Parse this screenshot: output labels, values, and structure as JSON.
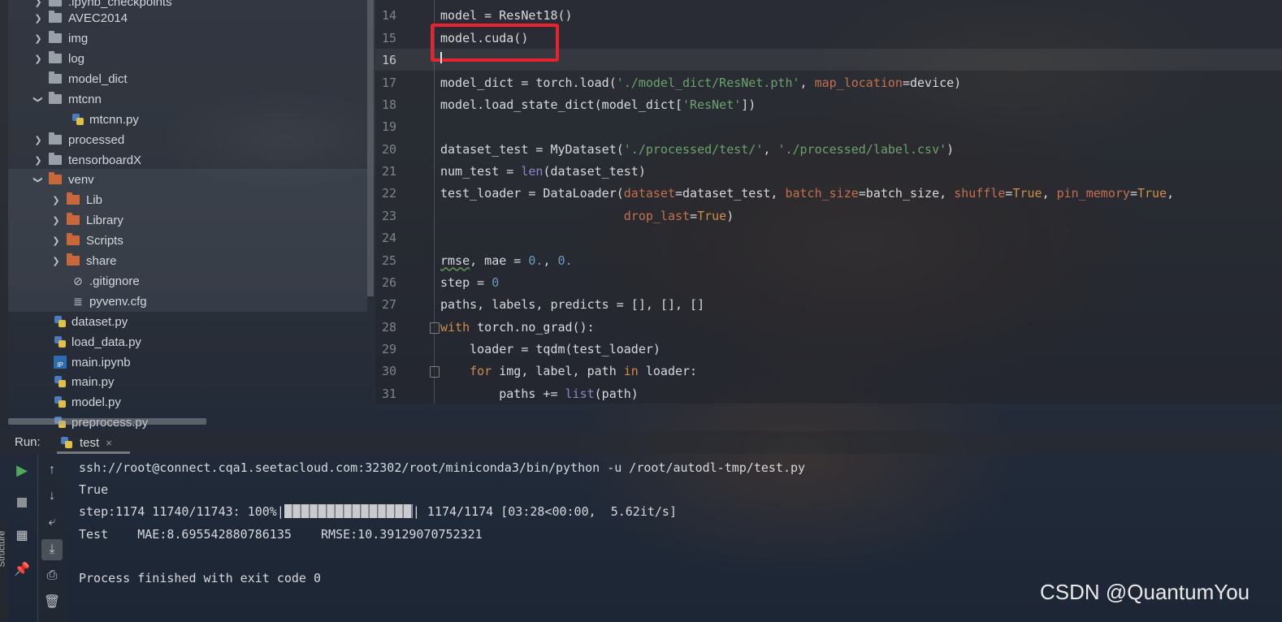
{
  "project_tree": {
    "items": [
      {
        "label": ".ipynb_checkpoints",
        "type": "folder",
        "expanded": false
      },
      {
        "label": "AVEC2014",
        "type": "folder",
        "expanded": false
      },
      {
        "label": "img",
        "type": "folder",
        "expanded": false
      },
      {
        "label": "log",
        "type": "folder",
        "expanded": false
      },
      {
        "label": "model_dict",
        "type": "folder",
        "expanded": false
      },
      {
        "label": "mtcnn",
        "type": "folder",
        "expanded": true
      },
      {
        "label": "mtcnn.py",
        "type": "python"
      },
      {
        "label": "processed",
        "type": "folder",
        "expanded": false
      },
      {
        "label": "tensorboardX",
        "type": "folder",
        "expanded": false
      },
      {
        "label": "venv",
        "type": "folder-excluded",
        "expanded": true
      },
      {
        "label": "Lib",
        "type": "folder-excluded",
        "expanded": false
      },
      {
        "label": "Library",
        "type": "folder-excluded",
        "expanded": false
      },
      {
        "label": "Scripts",
        "type": "folder-excluded",
        "expanded": false
      },
      {
        "label": "share",
        "type": "folder-excluded",
        "expanded": false
      },
      {
        "label": ".gitignore",
        "type": "ignore-file"
      },
      {
        "label": "pyvenv.cfg",
        "type": "config-file"
      },
      {
        "label": "dataset.py",
        "type": "python"
      },
      {
        "label": "load_data.py",
        "type": "python"
      },
      {
        "label": "main.ipynb",
        "type": "notebook"
      },
      {
        "label": "main.py",
        "type": "python"
      },
      {
        "label": "model.py",
        "type": "python"
      },
      {
        "label": "preprocess.py",
        "type": "python"
      }
    ]
  },
  "editor": {
    "line_numbers": [
      "14",
      "15",
      "16",
      "17",
      "18",
      "19",
      "20",
      "21",
      "22",
      "23",
      "24",
      "25",
      "26",
      "27",
      "28",
      "29",
      "30",
      "31"
    ],
    "current_line": "16",
    "highlighted_code": "model.cuda()"
  },
  "run_panel": {
    "label": "Run:",
    "tab_label": "test",
    "tab_close": "×",
    "side_label": "Structure",
    "console": {
      "command": "ssh://root@connect.cqa1.seetacloud.com:32302/root/miniconda3/bin/python -u /root/autodl-tmp/test.py",
      "line_true": "True",
      "progress_prefix": "step:1174 11740/11743: 100%|",
      "progress_suffix": "| 1174/1174 [03:28<00:00,  5.62it/s]",
      "progress_fraction": 1.0,
      "result": "Test    MAE:8.695542880786135    RMSE:10.39129070752321",
      "finished": "Process finished with exit code 0"
    }
  },
  "watermark": "CSDN @QuantumYou",
  "colors": {
    "highlight_box": "#e8232d",
    "keyword": "#cf8e4a",
    "string": "#6aa36b",
    "param": "#c4704e",
    "number": "#6d9cbe",
    "builtin": "#8c86c9"
  }
}
